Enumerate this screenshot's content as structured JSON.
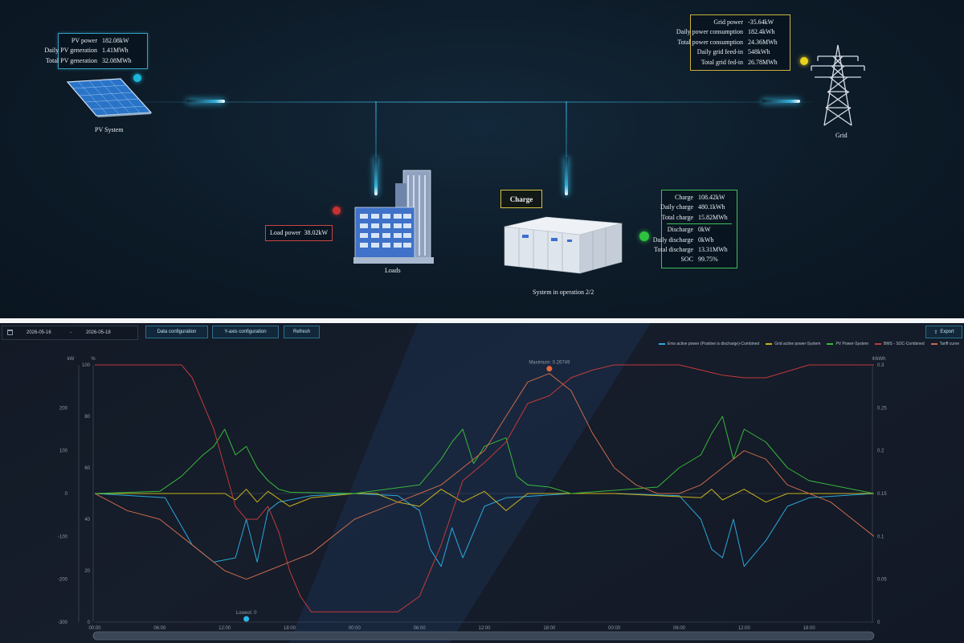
{
  "pv": {
    "caption": "PV System",
    "stats": [
      {
        "label": "PV power",
        "value": "182.08kW"
      },
      {
        "label": "Daily PV generation",
        "value": "1.41MWh"
      },
      {
        "label": "Total PV generation",
        "value": "32.08MWh"
      }
    ]
  },
  "grid": {
    "caption": "Grid",
    "stats": [
      {
        "label": "Grid power",
        "value": "-35.64kW"
      },
      {
        "label": "Daily power consumption",
        "value": "182.4kWh"
      },
      {
        "label": "Total power consumption",
        "value": "24.36MWh"
      },
      {
        "label": "Daily grid feed-in",
        "value": "548kWh"
      },
      {
        "label": "Total grid fed-in",
        "value": "26.78MWh"
      }
    ]
  },
  "load": {
    "caption": "Loads",
    "label": "Load power",
    "value": "38.02kW"
  },
  "ess": {
    "badge": "Charge",
    "caption": "System in operation 2/2",
    "stats": [
      {
        "label": "Charge",
        "value": "108.42kW"
      },
      {
        "label": "Daily charge",
        "value": "480.1kWh"
      },
      {
        "label": "Total charge",
        "value": "15.82MWh"
      },
      {
        "label": "Discharge",
        "value": "0kW"
      },
      {
        "label": "Daily discharge",
        "value": "0kWh"
      },
      {
        "label": "Total discharge",
        "value": "13.31MWh"
      },
      {
        "label": "SOC",
        "value": "99.75%"
      }
    ]
  },
  "colors": {
    "pv_status": "#1ab8d8",
    "grid_status": "#e8d21e",
    "load_status": "#c83232",
    "ess_status": "#2fc23f"
  },
  "toolbar": {
    "date_start": "2026-05-16",
    "date_sep": "-",
    "date_end": "2026-05-18",
    "calendar_icon": "calendar-icon",
    "data_config": "Data configuration",
    "yaxis_config": "Y-axis configuration",
    "refresh": "Refresh",
    "export": "Export",
    "export_icon": "export-icon"
  },
  "chart_data": {
    "type": "line",
    "title": "",
    "legend_position": "top-right",
    "grid": false,
    "y_left_unit": "kW",
    "y_left2_unit": "%",
    "y_right_unit": "¢/kWh",
    "y_left_ticks": [
      "200",
      "100",
      "0",
      "-100",
      "-200",
      "-300"
    ],
    "y_left2_ticks": [
      "100",
      "80",
      "60",
      "40",
      "20",
      "0"
    ],
    "y_right_ticks": [
      "0.3",
      "0.25",
      "0.2",
      "0.15",
      "0.1",
      "0.05",
      "0"
    ],
    "ylim_kw": [
      -300,
      300
    ],
    "ylim_pct": [
      0,
      100
    ],
    "ylim_price": [
      0,
      0.3
    ],
    "x_ticks": [
      "00:00",
      "06:00",
      "12:00",
      "18:00",
      "00:00",
      "06:00",
      "12:00",
      "18:00",
      "00:00",
      "06:00",
      "12:00",
      "18:00"
    ],
    "markers": {
      "max_label": "Maximum: 0.26749",
      "min_label": "Lowest: 0"
    },
    "series": [
      {
        "name": "Ems active power (Positive is discharge)-Combined",
        "color": "#29a9dc",
        "axis": "kw",
        "points": [
          [
            0,
            0
          ],
          [
            6.5,
            -10
          ],
          [
            9,
            -120
          ],
          [
            11,
            -160
          ],
          [
            13,
            -150
          ],
          [
            14,
            -60
          ],
          [
            15,
            -160
          ],
          [
            16,
            -40
          ],
          [
            17,
            -20
          ],
          [
            20,
            -5
          ],
          [
            24,
            0
          ],
          [
            28,
            -5
          ],
          [
            30,
            -40
          ],
          [
            31,
            -130
          ],
          [
            32,
            -170
          ],
          [
            33,
            -80
          ],
          [
            34,
            -150
          ],
          [
            36,
            -30
          ],
          [
            38,
            -10
          ],
          [
            44,
            0
          ],
          [
            48,
            0
          ],
          [
            54,
            -5
          ],
          [
            56,
            -60
          ],
          [
            57,
            -130
          ],
          [
            58,
            -150
          ],
          [
            59,
            -60
          ],
          [
            60,
            -170
          ],
          [
            62,
            -110
          ],
          [
            64,
            -30
          ],
          [
            66,
            -10
          ],
          [
            72,
            0
          ]
        ]
      },
      {
        "name": "Grid active power-System",
        "color": "#c9b21c",
        "axis": "kw",
        "points": [
          [
            0,
            0
          ],
          [
            12,
            0
          ],
          [
            13,
            -15
          ],
          [
            14,
            10
          ],
          [
            15,
            -20
          ],
          [
            16,
            5
          ],
          [
            18,
            -30
          ],
          [
            20,
            -10
          ],
          [
            24,
            0
          ],
          [
            26,
            0
          ],
          [
            28,
            -20
          ],
          [
            30,
            -30
          ],
          [
            32,
            10
          ],
          [
            34,
            -20
          ],
          [
            36,
            5
          ],
          [
            38,
            -40
          ],
          [
            40,
            0
          ],
          [
            44,
            0
          ],
          [
            48,
            0
          ],
          [
            56,
            -10
          ],
          [
            57,
            10
          ],
          [
            58,
            -15
          ],
          [
            60,
            10
          ],
          [
            62,
            -20
          ],
          [
            64,
            0
          ],
          [
            72,
            0
          ]
        ]
      },
      {
        "name": "PV Power-System",
        "color": "#36b83a",
        "axis": "kw",
        "points": [
          [
            0,
            0
          ],
          [
            6,
            5
          ],
          [
            8,
            40
          ],
          [
            10,
            90
          ],
          [
            11,
            110
          ],
          [
            12,
            150
          ],
          [
            13,
            90
          ],
          [
            14,
            110
          ],
          [
            15,
            60
          ],
          [
            16,
            30
          ],
          [
            17,
            10
          ],
          [
            18,
            3
          ],
          [
            24,
            0
          ],
          [
            30,
            20
          ],
          [
            32,
            80
          ],
          [
            33,
            120
          ],
          [
            34,
            150
          ],
          [
            35,
            70
          ],
          [
            36,
            110
          ],
          [
            38,
            130
          ],
          [
            39,
            40
          ],
          [
            40,
            20
          ],
          [
            42,
            15
          ],
          [
            44,
            0
          ],
          [
            52,
            15
          ],
          [
            54,
            60
          ],
          [
            56,
            90
          ],
          [
            57,
            140
          ],
          [
            58,
            180
          ],
          [
            59,
            80
          ],
          [
            60,
            150
          ],
          [
            62,
            120
          ],
          [
            64,
            60
          ],
          [
            66,
            30
          ],
          [
            72,
            0
          ]
        ]
      },
      {
        "name": "BMS - SOC-Combined",
        "color": "#c03a3a",
        "axis": "pct",
        "points": [
          [
            0,
            100
          ],
          [
            6,
            100
          ],
          [
            8,
            100
          ],
          [
            9,
            95
          ],
          [
            10,
            85
          ],
          [
            11,
            75
          ],
          [
            12,
            60
          ],
          [
            13,
            45
          ],
          [
            14,
            40
          ],
          [
            15,
            40
          ],
          [
            16,
            45
          ],
          [
            17,
            35
          ],
          [
            18,
            20
          ],
          [
            19,
            10
          ],
          [
            20,
            4
          ],
          [
            24,
            4
          ],
          [
            28,
            4
          ],
          [
            30,
            10
          ],
          [
            32,
            30
          ],
          [
            34,
            55
          ],
          [
            36,
            62
          ],
          [
            38,
            70
          ],
          [
            40,
            85
          ],
          [
            42,
            88
          ],
          [
            44,
            95
          ],
          [
            46,
            98
          ],
          [
            48,
            100
          ],
          [
            54,
            100
          ],
          [
            56,
            98
          ],
          [
            58,
            96
          ],
          [
            60,
            95
          ],
          [
            62,
            95
          ],
          [
            66,
            100
          ],
          [
            72,
            100
          ]
        ]
      },
      {
        "name": "Tariff curve",
        "color": "#c86a4a",
        "axis": "price",
        "points": [
          [
            0,
            0.15
          ],
          [
            3,
            0.13
          ],
          [
            6,
            0.12
          ],
          [
            8,
            0.1
          ],
          [
            10,
            0.08
          ],
          [
            12,
            0.06
          ],
          [
            14,
            0.05
          ],
          [
            16,
            0.06
          ],
          [
            18,
            0.07
          ],
          [
            20,
            0.08
          ],
          [
            22,
            0.1
          ],
          [
            24,
            0.12
          ],
          [
            26,
            0.13
          ],
          [
            28,
            0.14
          ],
          [
            30,
            0.15
          ],
          [
            32,
            0.16
          ],
          [
            34,
            0.18
          ],
          [
            36,
            0.2
          ],
          [
            38,
            0.24
          ],
          [
            40,
            0.28
          ],
          [
            42,
            0.29
          ],
          [
            44,
            0.27
          ],
          [
            46,
            0.22
          ],
          [
            48,
            0.18
          ],
          [
            50,
            0.16
          ],
          [
            52,
            0.15
          ],
          [
            54,
            0.15
          ],
          [
            56,
            0.16
          ],
          [
            58,
            0.18
          ],
          [
            60,
            0.2
          ],
          [
            62,
            0.19
          ],
          [
            64,
            0.16
          ],
          [
            66,
            0.15
          ],
          [
            68,
            0.14
          ],
          [
            70,
            0.12
          ],
          [
            72,
            0.1
          ]
        ]
      }
    ]
  }
}
